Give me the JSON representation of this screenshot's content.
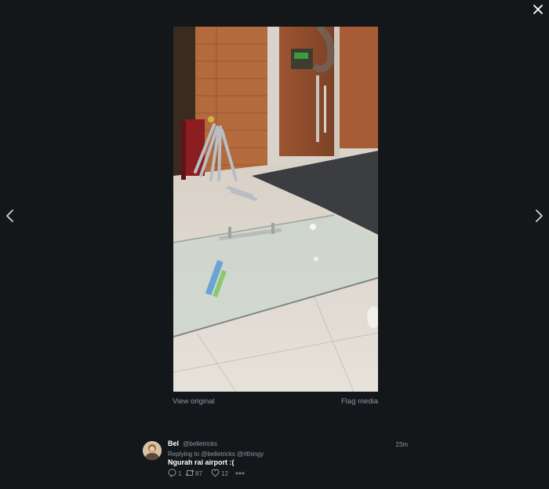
{
  "media": {
    "view_original_label": "View original",
    "flag_media_label": "Flag media"
  },
  "tweet": {
    "display_name": "Bel",
    "handle": "@belletricks",
    "timestamp": "23m",
    "replying_to": "Replying to @belletricks @rlthingy",
    "text": "Ngurah rai airport :(",
    "reply_count": "1",
    "retweet_count": "87",
    "like_count": "12"
  },
  "icons": {
    "close": "close-icon",
    "prev": "chevron-left-icon",
    "next": "chevron-right-icon",
    "reply": "reply-icon",
    "retweet": "retweet-icon",
    "like": "heart-icon",
    "more": "more-icon"
  },
  "colors": {
    "background": "#14171a",
    "secondary_text": "#8899a6",
    "primary_text": "#ffffff"
  }
}
